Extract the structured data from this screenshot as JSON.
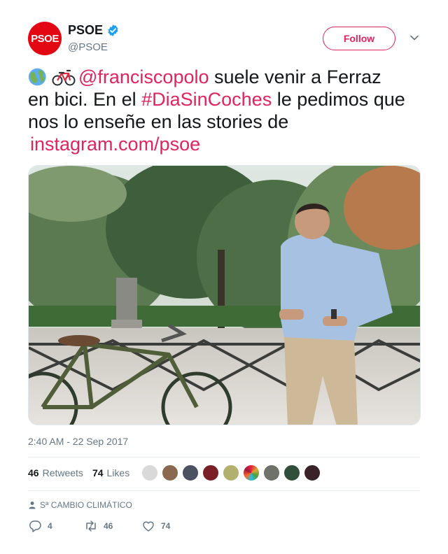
{
  "author": {
    "avatar_text": "PSOE",
    "name": "PSOE",
    "handle": "@PSOE",
    "brand_color": "#e30613"
  },
  "follow_label": "Follow",
  "text": {
    "mention": "@franciscopolo",
    "part1": " suele venir a Ferraz",
    "part2": "en bici. En el ",
    "hashtag": "#DiaSinCoches",
    "part3": " le pedimos que",
    "part4": "nos lo enseñe en las stories de",
    "url": "instagram.com/psoe"
  },
  "timestamp": "2:40 AM - 22 Sep 2017",
  "stats": {
    "retweets_count": "46",
    "retweets_label": "Retweets",
    "likes_count": "74",
    "likes_label": "Likes"
  },
  "context_label": "Sª CAMBIO CLIMÁTICO",
  "actions": {
    "reply_count": "4",
    "retweet_count": "46",
    "like_count": "74"
  },
  "colors": {
    "link": "#e0245e",
    "secondary_text": "#657786",
    "verified": "#1da1f2"
  },
  "icons": [
    "verified-icon",
    "chevron-down-icon",
    "globe-emoji-icon",
    "bicycle-emoji-icon",
    "person-icon",
    "reply-icon",
    "retweet-icon",
    "heart-icon"
  ]
}
